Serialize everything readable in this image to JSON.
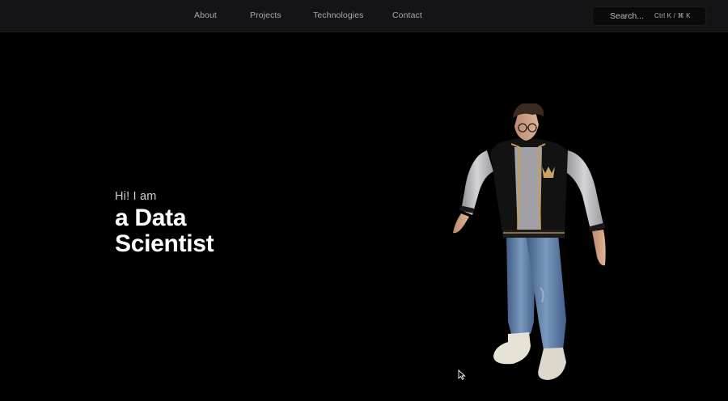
{
  "nav": {
    "links": [
      {
        "label": "About"
      },
      {
        "label": "Projects"
      },
      {
        "label": "Technologies"
      },
      {
        "label": "Contact"
      }
    ]
  },
  "search": {
    "placeholder": "Search...",
    "shortcut": "Ctrl K / ⌘ K"
  },
  "hero": {
    "greeting": "Hi! I am",
    "title": "a Data Scientist"
  },
  "colors": {
    "background": "#000000",
    "navbar": "#141416",
    "nav_text": "#a7a7ad",
    "jacket": "#111111",
    "sleeves": "#c9c9cc",
    "jeans": "#5f7fa8",
    "shoes": "#e6e2d6"
  },
  "icons": {
    "cursor": "mouse-pointer-icon",
    "crown": "crown-icon"
  }
}
